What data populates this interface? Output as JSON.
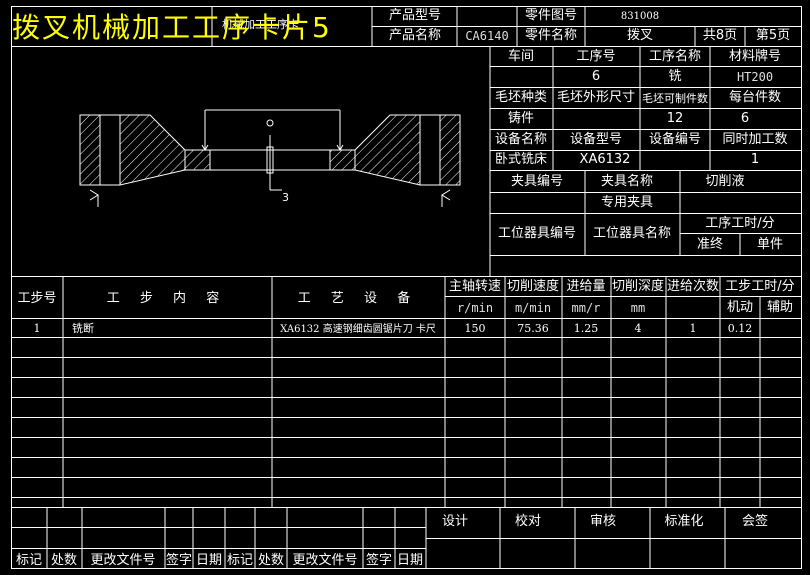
{
  "overlay_title": "拨叉机械加工工序卡片5",
  "header": {
    "card_title": "机械加工工序卡",
    "product_model_label": "产品型号",
    "product_model_value": "",
    "product_name_label": "产品名称",
    "product_name_value": "CA6140",
    "part_no_label": "零件图号",
    "part_no_value": "831008",
    "part_name_label": "零件名称",
    "part_name_value": "拨叉",
    "total_pages": "共8页",
    "page_no": "第5页"
  },
  "info": {
    "workshop_label": "车间",
    "op_no_label": "工序号",
    "op_name_label": "工序名称",
    "material_label": "材料牌号",
    "workshop_value": "",
    "op_no_value": "6",
    "op_name_value": "铣",
    "material_value": "HT200",
    "blank_type_label": "毛坯种类",
    "blank_size_label": "毛坯外形尺寸",
    "pieces_per_blank_label": "毛坯可制件数",
    "pieces_per_unit_label": "每台件数",
    "blank_type_value": "铸件",
    "blank_size_value": "",
    "pieces_per_blank_value": "12",
    "pieces_per_unit_value": "6",
    "equip_name_label": "设备名称",
    "equip_model_label": "设备型号",
    "equip_no_label": "设备编号",
    "simul_label": "同时加工数",
    "equip_name_value": "卧式铣床",
    "equip_model_value": "XA6132",
    "equip_no_value": "",
    "simul_value": "1",
    "fixture_no_label": "夹具编号",
    "fixture_name_label": "夹具名称",
    "coolant_label": "切削液",
    "fixture_name_value": "专用夹具",
    "station_tool_no_label": "工位器具编号",
    "station_tool_name_label": "工位器具名称",
    "op_time_label": "工序工时/分",
    "prep_label": "准终",
    "unit_label": "单件"
  },
  "drawing": {
    "dimension_label": "3"
  },
  "steps_table": {
    "headers": {
      "step_no": "工步号",
      "content": "工 步 内 容",
      "equipment": "工 艺 设 备",
      "spindle": "主轴转速",
      "cut_speed": "切削速度",
      "feed": "进给量",
      "depth": "切削深度",
      "passes": "进给次数",
      "step_time": "工步工时/分",
      "machine": "机动",
      "aux": "辅助"
    },
    "units": {
      "spindle": "r/min",
      "cut_speed": "m/min",
      "feed": "mm/r",
      "depth": "mm"
    },
    "rows": [
      {
        "step_no": "1",
        "content": "铣断",
        "equipment": "XA6132 高速钢细齿圆锯片刀 卡尺",
        "spindle": "150",
        "cut_speed": "75.36",
        "feed": "1.25",
        "depth": "4",
        "passes": "1",
        "machine": "0.12",
        "aux": ""
      }
    ]
  },
  "signoff": {
    "design": "设计",
    "check": "校对",
    "review": "审核",
    "standard": "标准化",
    "countersign": "会签",
    "footer": [
      "标记",
      "处数",
      "更改文件号",
      "签字",
      "日期",
      "标记",
      "处数",
      "更改文件号",
      "签字",
      "日期"
    ]
  },
  "colors": {
    "background": "#000000",
    "line": "#ffffff",
    "overlay_text": "#ffff00"
  }
}
